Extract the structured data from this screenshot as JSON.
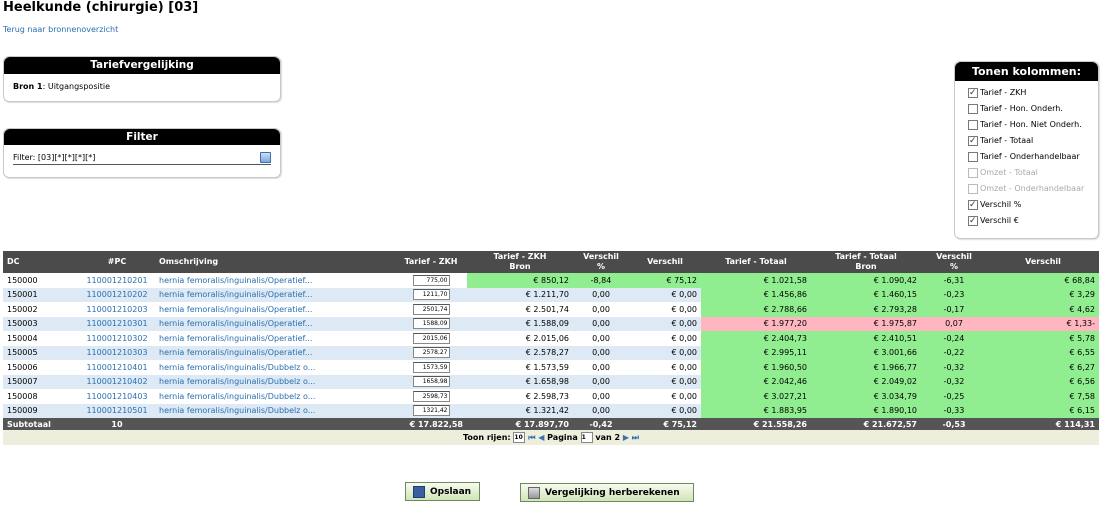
{
  "page": {
    "title": "Heelkunde (chirurgie) [03]",
    "back_link": "Terug naar bronnenoverzicht"
  },
  "tariefvergelijking": {
    "title": "Tariefvergelijking",
    "source_label": "Bron 1",
    "source_value": ": Uitgangspositie"
  },
  "filter": {
    "title": "Filter",
    "label": "Filter:",
    "value": "[03][*][*][*][*]"
  },
  "columns_panel": {
    "title": "Tonen kolommen:",
    "options": [
      {
        "label": "Tarief - ZKH",
        "checked": true,
        "disabled": false
      },
      {
        "label": "Tarief - Hon. Onderh.",
        "checked": false,
        "disabled": false
      },
      {
        "label": "Tarief - Hon. Niet Onderh.",
        "checked": false,
        "disabled": false
      },
      {
        "label": "Tarief - Totaal",
        "checked": true,
        "disabled": false
      },
      {
        "label": "Tarief - Onderhandelbaar",
        "checked": false,
        "disabled": false
      },
      {
        "label": "Omzet - Totaal",
        "checked": false,
        "disabled": true
      },
      {
        "label": "Omzet - Onderhandelbaar",
        "checked": false,
        "disabled": true
      },
      {
        "label": "Verschil %",
        "checked": true,
        "disabled": false
      },
      {
        "label": "Verschil €",
        "checked": true,
        "disabled": false
      }
    ]
  },
  "table": {
    "headers": {
      "dc": "DC",
      "pc": "#PC",
      "omschrijving": "Omschrijving",
      "tarief_zkh": "Tarief - ZKH",
      "tarief_zkh_bron_1": "Tarief - ZKH",
      "tarief_zkh_bron_2": "Bron",
      "verschil_pct_1": "Verschil",
      "verschil_pct_2": "%",
      "verschil_eur": "Verschil",
      "tarief_totaal": "Tarief - Totaal",
      "tarief_totaal_bron_1": "Tarief - Totaal",
      "tarief_totaal_bron_2": "Bron",
      "verschil2_pct_1": "Verschil",
      "verschil2_pct_2": "%",
      "verschil2_eur": "Verschil"
    },
    "rows": [
      {
        "dc": "150000",
        "pc": "110001210201",
        "desc": "hernia femoralis/inguinalis/Operatief...",
        "zkh": "775,00",
        "zkh_bron": "€ 850,12",
        "vpct": "-8,84",
        "veur": "€ 75,12",
        "tot": "€ 1.021,58",
        "tot_bron": "€ 1.090,42",
        "vpct2": "-6,31",
        "veur2": "€ 68,84",
        "zkh_status": "green",
        "tot_status": "green"
      },
      {
        "dc": "150001",
        "pc": "110001210202",
        "desc": "hernia femoralis/inguinalis/Operatief...",
        "zkh": "1211,70",
        "zkh_bron": "€ 1.211,70",
        "vpct": "0,00",
        "veur": "€ 0,00",
        "tot": "€ 1.456,86",
        "tot_bron": "€ 1.460,15",
        "vpct2": "-0,23",
        "veur2": "€ 3,29",
        "zkh_status": "none",
        "tot_status": "green"
      },
      {
        "dc": "150002",
        "pc": "110001210203",
        "desc": "hernia femoralis/inguinalis/Operatief...",
        "zkh": "2501,74",
        "zkh_bron": "€ 2.501,74",
        "vpct": "0,00",
        "veur": "€ 0,00",
        "tot": "€ 2.788,66",
        "tot_bron": "€ 2.793,28",
        "vpct2": "-0,17",
        "veur2": "€ 4,62",
        "zkh_status": "none",
        "tot_status": "green"
      },
      {
        "dc": "150003",
        "pc": "110001210301",
        "desc": "hernia femoralis/inguinalis/Operatief...",
        "zkh": "1588,09",
        "zkh_bron": "€ 1.588,09",
        "vpct": "0,00",
        "veur": "€ 0,00",
        "tot": "€ 1.977,20",
        "tot_bron": "€ 1.975,87",
        "vpct2": "0,07",
        "veur2": "€ 1,33-",
        "zkh_status": "none",
        "tot_status": "pink"
      },
      {
        "dc": "150004",
        "pc": "110001210302",
        "desc": "hernia femoralis/inguinalis/Operatief...",
        "zkh": "2015,06",
        "zkh_bron": "€ 2.015,06",
        "vpct": "0,00",
        "veur": "€ 0,00",
        "tot": "€ 2.404,73",
        "tot_bron": "€ 2.410,51",
        "vpct2": "-0,24",
        "veur2": "€ 5,78",
        "zkh_status": "none",
        "tot_status": "green"
      },
      {
        "dc": "150005",
        "pc": "110001210303",
        "desc": "hernia femoralis/inguinalis/Operatief...",
        "zkh": "2578,27",
        "zkh_bron": "€ 2.578,27",
        "vpct": "0,00",
        "veur": "€ 0,00",
        "tot": "€ 2.995,11",
        "tot_bron": "€ 3.001,66",
        "vpct2": "-0,22",
        "veur2": "€ 6,55",
        "zkh_status": "none",
        "tot_status": "green"
      },
      {
        "dc": "150006",
        "pc": "110001210401",
        "desc": "hernia femoralis/inguinalis/Dubbelz o...",
        "zkh": "1573,59",
        "zkh_bron": "€ 1.573,59",
        "vpct": "0,00",
        "veur": "€ 0,00",
        "tot": "€ 1.960,50",
        "tot_bron": "€ 1.966,77",
        "vpct2": "-0,32",
        "veur2": "€ 6,27",
        "zkh_status": "none",
        "tot_status": "green"
      },
      {
        "dc": "150007",
        "pc": "110001210402",
        "desc": "hernia femoralis/inguinalis/Dubbelz o...",
        "zkh": "1658,98",
        "zkh_bron": "€ 1.658,98",
        "vpct": "0,00",
        "veur": "€ 0,00",
        "tot": "€ 2.042,46",
        "tot_bron": "€ 2.049,02",
        "vpct2": "-0,32",
        "veur2": "€ 6,56",
        "zkh_status": "none",
        "tot_status": "green"
      },
      {
        "dc": "150008",
        "pc": "110001210403",
        "desc": "hernia femoralis/inguinalis/Dubbelz o...",
        "zkh": "2598,73",
        "zkh_bron": "€ 2.598,73",
        "vpct": "0,00",
        "veur": "€ 0,00",
        "tot": "€ 3.027,21",
        "tot_bron": "€ 3.034,79",
        "vpct2": "-0,25",
        "veur2": "€ 7,58",
        "zkh_status": "none",
        "tot_status": "green"
      },
      {
        "dc": "150009",
        "pc": "110001210501",
        "desc": "hernia femoralis/inguinalis/Dubbelz o...",
        "zkh": "1321,42",
        "zkh_bron": "€ 1.321,42",
        "vpct": "0,00",
        "veur": "€ 0,00",
        "tot": "€ 1.883,95",
        "tot_bron": "€ 1.890,10",
        "vpct2": "-0,33",
        "veur2": "€ 6,15",
        "zkh_status": "none",
        "tot_status": "green"
      }
    ],
    "subtotal": {
      "label": "Subtotaal",
      "count": "10",
      "zkh": "€ 17.822,58",
      "zkh_bron": "€ 17.897,70",
      "vpct": "-0,42",
      "veur": "€ 75,12",
      "tot": "€ 21.558,26",
      "tot_bron": "€ 21.672,57",
      "vpct2": "-0,53",
      "veur2": "€ 114,31"
    },
    "pager": {
      "rows_label": "Toon rijen:",
      "rows_value": "10",
      "page_label": "Pagina",
      "page_value": "1",
      "of_label": "van",
      "total_pages": "2"
    }
  },
  "buttons": {
    "save": "Opslaan",
    "recalc": "Vergelijking herberekenen"
  },
  "colors": {
    "green": "#90ee90",
    "pink": "#ffb6c1",
    "link": "#2a6fb0",
    "header": "#4b4b4b"
  }
}
